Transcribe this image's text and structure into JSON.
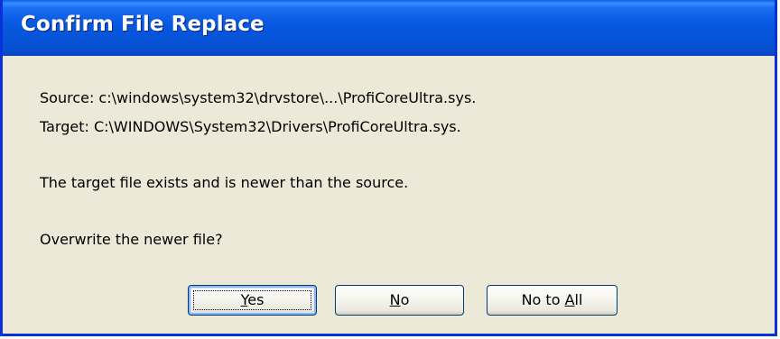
{
  "dialog": {
    "title": "Confirm File Replace",
    "source_line": "Source: c:\\windows\\system32\\drvstore\\...\\ProfiCoreUltra.sys.",
    "target_line": "Target: C:\\WINDOWS\\System32\\Drivers\\ProfiCoreUltra.sys.",
    "status_message": "The target file exists and is newer than the source.",
    "question": "Overwrite the newer file?"
  },
  "buttons": {
    "yes": {
      "label_mnemonic": "Y",
      "label_rest": "es"
    },
    "no": {
      "label_mnemonic": "N",
      "label_rest": "o"
    },
    "no_to_all": {
      "label_prefix": "No to ",
      "label_mnemonic": "A",
      "label_rest": "ll"
    }
  },
  "colors": {
    "title_bar": "#0553d8",
    "dialog_background": "#ece9d8",
    "button_border": "#003c74"
  }
}
